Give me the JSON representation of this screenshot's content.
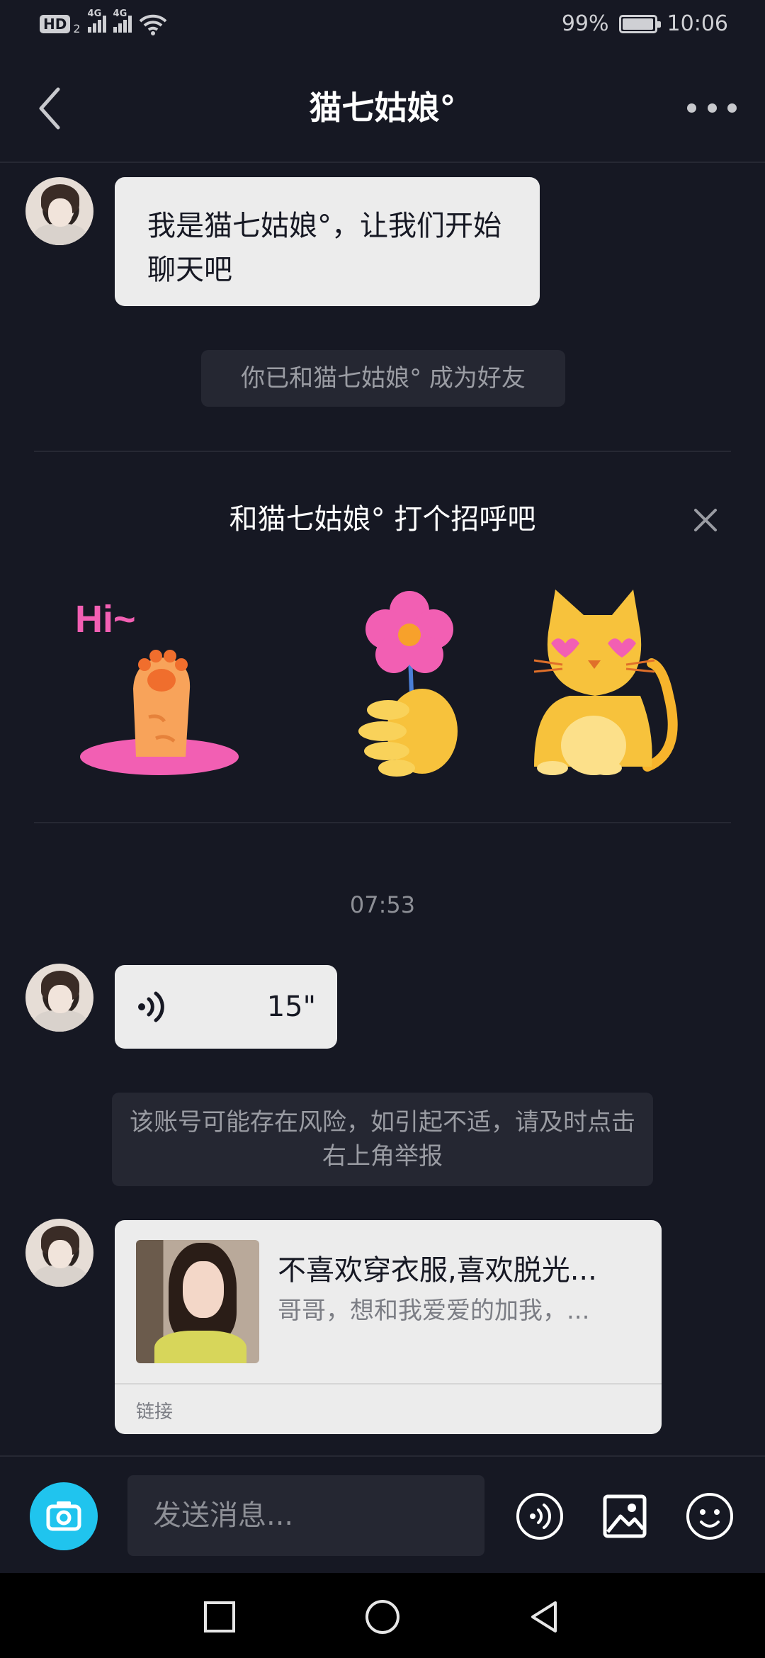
{
  "status_bar": {
    "hd_label": "HD",
    "hd_sub": "2",
    "signal1_label": "4G",
    "signal2_label": "4G",
    "battery": "99%",
    "time": "10:06"
  },
  "header": {
    "title": "猫七姑娘°"
  },
  "messages": {
    "first_text": "我是猫七姑娘°，让我们开始聊天吧",
    "friend_notice": "你已和猫七姑娘° 成为好友",
    "greeting_title": "和猫七姑娘° 打个招呼吧",
    "sticker_hi_text": "Hi~",
    "timestamp": "07:53",
    "voice_duration": "15\"",
    "risk_notice": "该账号可能存在风险，如引起不适，请及时点击右上角举报",
    "link_title": "不喜欢穿衣服,喜欢脱光...",
    "link_desc": "哥哥，想和我爱爱的加我，...",
    "link_tag": "链接"
  },
  "input": {
    "placeholder": "发送消息..."
  },
  "icons": {
    "back": "chevron-left-icon",
    "more": "more-dots-icon",
    "close": "close-icon",
    "voice": "voice-wave-icon",
    "camera": "camera-icon",
    "image": "image-icon",
    "emoji": "emoji-icon"
  },
  "colors": {
    "background": "#161823",
    "bubble": "#ececec",
    "system_pill": "#252732",
    "camera_accent": "#20c4ee",
    "sticker_pink": "#f25fb3",
    "sticker_yellow": "#f7c23c"
  }
}
